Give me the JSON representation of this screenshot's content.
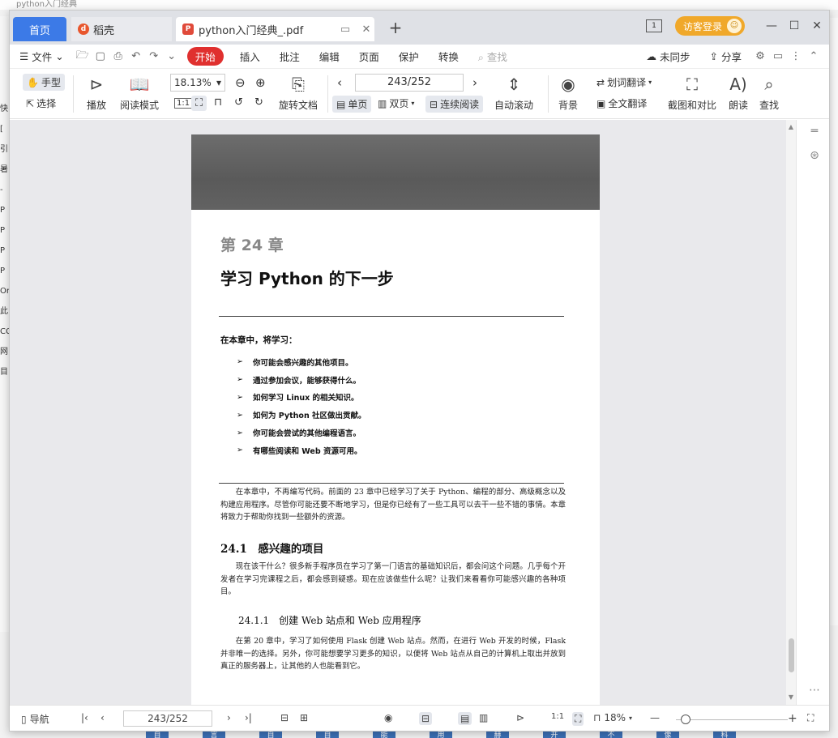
{
  "background": {
    "title": "python入门经典",
    "left_letters": [
      "快",
      "[",
      "引",
      "暑",
      "-",
      "P",
      "P",
      "P",
      "P",
      "Or",
      "此",
      "CC",
      "网",
      "目"
    ],
    "bottom_letters": [
      "自",
      "言",
      "自",
      "自",
      "能",
      "用",
      "赫",
      "开",
      "不",
      "像",
      "科"
    ]
  },
  "tabs": {
    "home": "首页",
    "daoke": "稻壳",
    "pdf": "python入门经典_.pdf"
  },
  "titlebar": {
    "login": "访客登录"
  },
  "menu": {
    "file": "文件",
    "items": [
      "开始",
      "插入",
      "批注",
      "编辑",
      "页面",
      "保护",
      "转换"
    ],
    "search": "查找",
    "sync": "未同步",
    "share": "分享"
  },
  "ribbon": {
    "hand": "手型",
    "select": "选择",
    "play": "播放",
    "read_mode": "阅读模式",
    "zoom": "18.13%",
    "rotate": "旋转文档",
    "page_indicator": "243/252",
    "single": "单页",
    "double": "双页",
    "continuous": "连续阅读",
    "auto_scroll": "自动滚动",
    "background": "背景",
    "word_translate": "划词翻译",
    "full_translate": "全文翻译",
    "screenshot": "截图和对比",
    "read_aloud": "朗读",
    "find": "查找"
  },
  "document": {
    "chapter": "第 24 章",
    "title": "学习 Python 的下一步",
    "learn_heading": "在本章中，将学习：",
    "bullets": [
      "你可能会感兴趣的其他项目。",
      "通过参加会议，能够获得什么。",
      "如何学习 Linux 的相关知识。",
      "如何为 Python 社区做出贡献。",
      "你可能会尝试的其他编程语言。",
      "有哪些阅读和 Web 资源可用。"
    ],
    "intro": "在本章中，不再编写代码。前面的 23 章中已经学习了关于 Python、编程的部分、高级概念以及构建应用程序。尽管你可能还要不断地学习，但是你已经有了一些工具可以去干一些不错的事情。本章将致力于帮助你找到一些额外的资源。",
    "h2": "24.1　感兴趣的项目",
    "p2": "现在该干什么？很多新手程序员在学习了第一门语言的基础知识后，都会问这个问题。几乎每个开发者在学习完课程之后，都会感到疑惑。现在应该做些什么呢？让我们来看看你可能感兴趣的各种项目。",
    "h3": "24.1.1　创建 Web 站点和 Web 应用程序",
    "p3": "在第 20 章中，学习了如何使用 Flask 创建 Web 站点。然而，在进行 Web 开发的时候，Flask 并非唯一的选择。另外，你可能想要学习更多的知识，以便将 Web 站点从自己的计算机上取出并放到真正的服务器上，让其他的人也能看到它。"
  },
  "statusbar": {
    "nav": "导航",
    "page": "243/252",
    "zoom": "18%"
  }
}
